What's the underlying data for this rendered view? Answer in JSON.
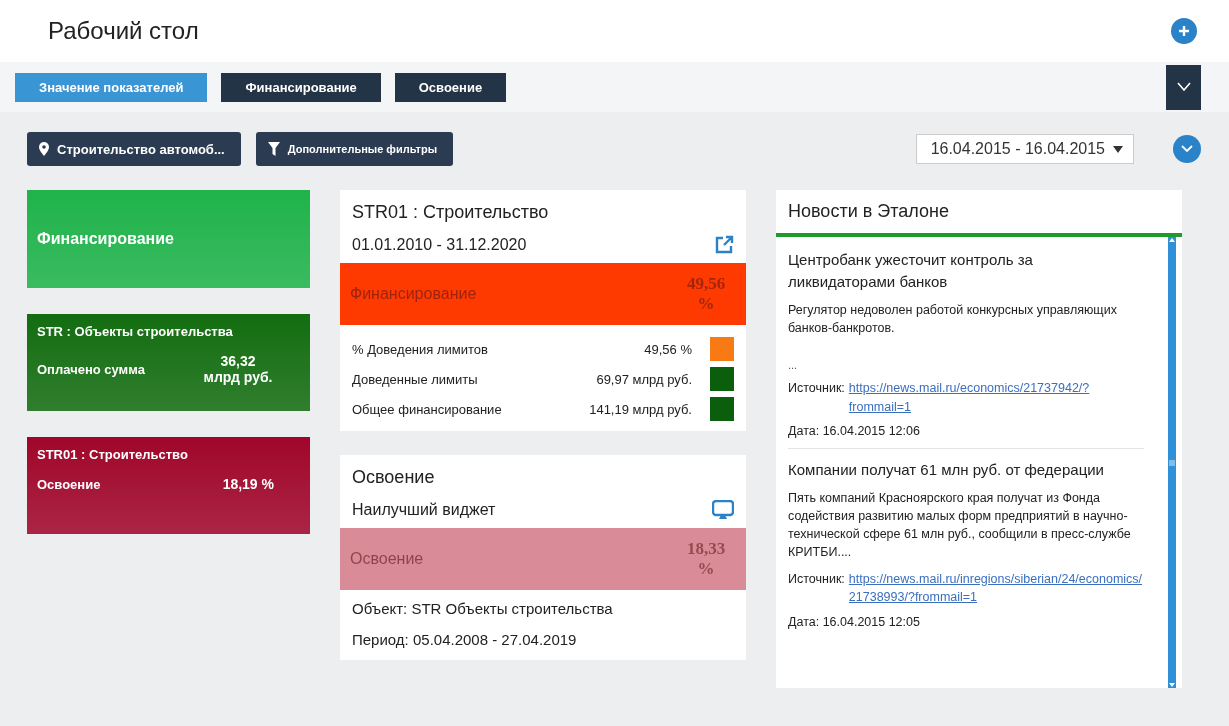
{
  "page": {
    "title": "Рабочий стол"
  },
  "tabs": [
    {
      "label": "Значение показателей",
      "selected": true
    },
    {
      "label": "Финансирование",
      "selected": false
    },
    {
      "label": "Освоение",
      "selected": false
    }
  ],
  "filters": {
    "object": "Строительство автомоб...",
    "more": "Дополнительные фильтры",
    "date_range": "16.04.2015 - 16.04.2015"
  },
  "tiles": [
    {
      "kind": "label",
      "color": "#1fb34a",
      "title": "Финансирование"
    },
    {
      "kind": "metric",
      "color": "#136d10",
      "title": "STR : Объекты строительства",
      "label": "Оплачено сумма",
      "value": "36,32 млрд руб."
    },
    {
      "kind": "metric",
      "color": "#a0062a",
      "title": "STR01 : Строительство",
      "label": "Освоение",
      "value": "18,19 %"
    }
  ],
  "widgets": [
    {
      "kind": "limits",
      "title": "STR01 : Строительство",
      "subtitle": "01.01.2010 - 31.12.2020",
      "banner": {
        "label": "Финансирование",
        "value": "49,56 %",
        "color": "#ff3a00"
      },
      "rows": [
        {
          "label": "% Доведения лимитов",
          "value": "49,56 %",
          "color": "#f87a14"
        },
        {
          "label": "Доведенные лимиты",
          "value": "69,97 млрд руб.",
          "color": "#0b5e0b"
        },
        {
          "label": "Общее финансирование",
          "value": "141,19 млрд руб.",
          "color": "#0b5e0b"
        }
      ]
    },
    {
      "kind": "info",
      "title": "Освоение",
      "subtitle": "Наилучший виджет",
      "banner": {
        "label": "Освоение",
        "value": "18,33 %",
        "color": "#d98c97"
      },
      "lines": [
        "Объект: STR Объекты строительства",
        "Период: 05.04.2008 - 27.04.2019"
      ]
    }
  ],
  "news": {
    "title": "Новости в Эталоне",
    "items": [
      {
        "title": "Центробанк ужесточит контроль за ликвидаторами банков",
        "text": "Регулятор недоволен работой конкурсных управляющих банков-банкротов.",
        "more": "...",
        "source_label": "Источник:",
        "source": "https://news.mail.ru/economics/21737942/?frommail=1",
        "date": "Дата: 16.04.2015 12:06"
      },
      {
        "title": "Компании получат 61 млн руб. от федерации",
        "text": "Пять компаний Красноярского края получат из Фонда содействия развитию малых форм предприятий в научно-технической сфере 61 млн руб., сообщили в пресс-службе КРИТБИ....",
        "source_label": "Источник:",
        "source": "https://news.mail.ru/inregions/siberian/24/economics/21738993/?frommail=1",
        "date": "Дата: 16.04.2015 12:05"
      }
    ]
  }
}
